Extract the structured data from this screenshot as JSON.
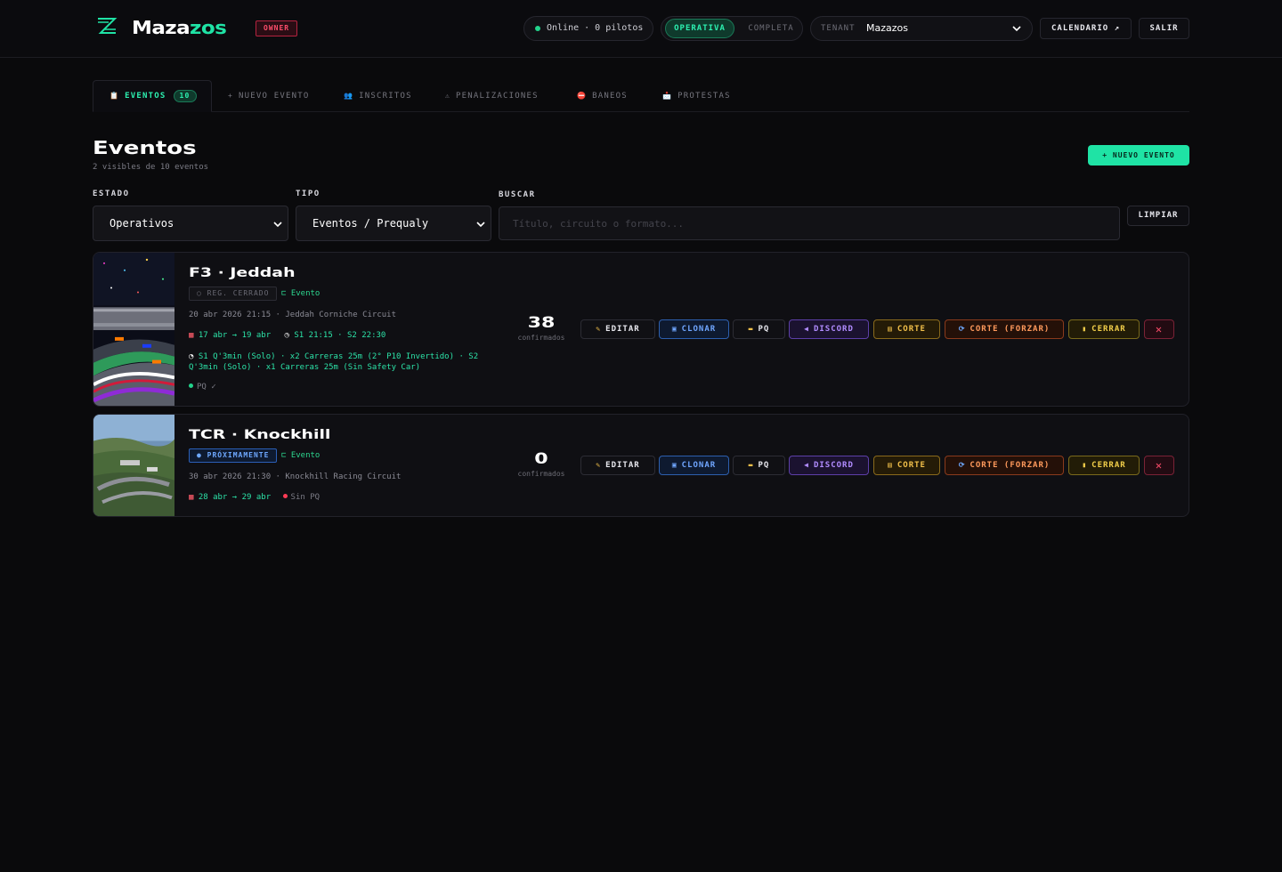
{
  "app": {
    "logo_part1": "Maza",
    "logo_part2": "zos",
    "role_badge": "OWNER"
  },
  "header": {
    "online_status": "Online · 0 pilotos",
    "mode_active": "OPERATIVA",
    "mode_inactive": "COMPLETA",
    "tenant_label": "TENANT",
    "tenant_value": "Mazazos",
    "calendar_button": "CALENDARIO ↗",
    "exit_button": "SALIR"
  },
  "tabs": [
    {
      "label": "EVENTOS",
      "icon": "📋",
      "count": "10",
      "active": true
    },
    {
      "label": "NUEVO EVENTO",
      "icon": "+",
      "active": false
    },
    {
      "label": "INSCRITOS",
      "icon": "👥",
      "active": false
    },
    {
      "label": "PENALIZACIONES",
      "icon": "⚠",
      "active": false
    },
    {
      "label": "BANEOS",
      "icon": "⛔",
      "active": false
    },
    {
      "label": "PROTESTAS",
      "icon": "📩",
      "active": false
    }
  ],
  "page": {
    "title": "Eventos",
    "subtitle": "2 visibles de 10 eventos",
    "new_event_button": "+ NUEVO EVENTO"
  },
  "filters": {
    "estado_label": "ESTADO",
    "estado_value": "Operativos",
    "tipo_label": "TIPO",
    "tipo_value": "Eventos / Prequaly",
    "buscar_label": "BUSCAR",
    "search_placeholder": "Título, circuito o formato...",
    "clear_button": "LIMPIAR"
  },
  "actions": {
    "edit": "EDITAR",
    "clone": "CLONAR",
    "pq": "PQ",
    "discord": "DISCORD",
    "corte": "CORTE",
    "corte_forzar": "CORTE (FORZAR)",
    "cerrar": "CERRAR",
    "delete": "✕",
    "confirmed_label": "confirmados"
  },
  "events": [
    {
      "title": "F3 · Jeddah",
      "status": "○ REG. CERRADO",
      "type": "Evento",
      "datetime_circuit": "20 abr 2026 21:15 · Jeddah Corniche Circuit",
      "reg_dates": "17 abr → 19 abr",
      "sessions": "S1 21:15 · S2 22:30",
      "format": "S1 Q'3min (Solo) · x2 Carreras 25m (2° P10 Invertido) · S2 Q'3min (Solo) · x1 Carreras 25m (Sin Safety Car)",
      "pq_status": "PQ ✓",
      "confirmed": "38"
    },
    {
      "title": "TCR · Knockhill",
      "status": "● PRÓXIMAMENTE",
      "type": "Evento",
      "datetime_circuit": "30 abr 2026 21:30 · Knockhill Racing Circuit",
      "reg_dates": "28 abr → 29 abr",
      "pq_status": "Sin PQ",
      "confirmed": "0"
    }
  ],
  "colors": {
    "accent": "#1fe3a5",
    "background": "#0a0a0c",
    "danger": "#ff4d6b"
  }
}
